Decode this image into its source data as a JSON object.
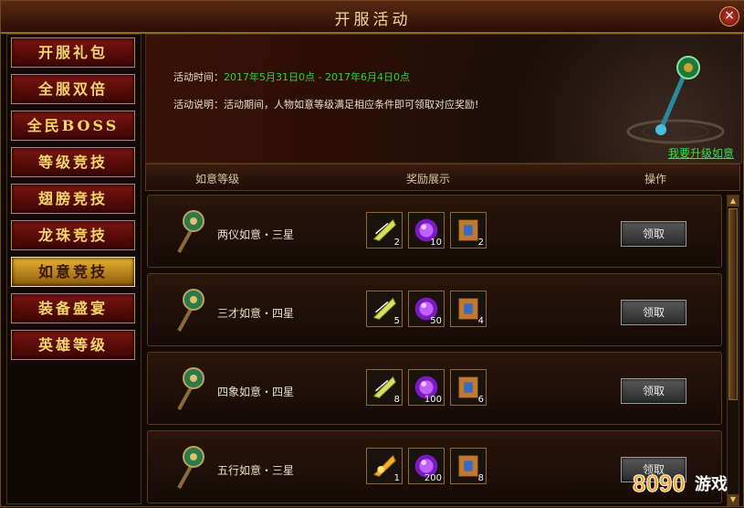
{
  "window": {
    "title": "开服活动",
    "close_label": "×"
  },
  "sidebar": {
    "items": [
      {
        "label": "开服礼包",
        "active": false
      },
      {
        "label": "全服双倍",
        "active": false
      },
      {
        "label": "全民BOSS",
        "active": false
      },
      {
        "label": "等级竞技",
        "active": false
      },
      {
        "label": "翅膀竞技",
        "active": false
      },
      {
        "label": "龙珠竞技",
        "active": false
      },
      {
        "label": "如意竞技",
        "active": true
      },
      {
        "label": "装备盛宴",
        "active": false
      },
      {
        "label": "英雄等级",
        "active": false
      }
    ]
  },
  "banner": {
    "time_label": "活动时间：",
    "time_value": "2017年5月31日0点 - 2017年6月4日0点",
    "desc_label": "活动说明：",
    "desc_value": "活动期间，人物如意等级满足相应条件即可领取对应奖励!",
    "upgrade_link": "我要升级如意"
  },
  "columns": {
    "level": "如意等级",
    "rewards": "奖励展示",
    "action": "操作"
  },
  "rows": [
    {
      "name": "两仪如意・三星",
      "icon": "ruyi-scepter-icon",
      "rewards": [
        {
          "icon": "wing-feather-icon",
          "count": "2"
        },
        {
          "icon": "purple-orb-icon",
          "count": "10"
        },
        {
          "icon": "scroll-icon",
          "count": "2"
        }
      ],
      "button": "领取"
    },
    {
      "name": "三才如意・四星",
      "icon": "ruyi-scepter-icon",
      "rewards": [
        {
          "icon": "wing-feather-icon",
          "count": "5"
        },
        {
          "icon": "purple-orb-icon",
          "count": "50"
        },
        {
          "icon": "scroll-icon",
          "count": "4"
        }
      ],
      "button": "领取"
    },
    {
      "name": "四象如意・四星",
      "icon": "ruyi-scepter-icon",
      "rewards": [
        {
          "icon": "wing-feather-icon",
          "count": "8"
        },
        {
          "icon": "purple-orb-icon",
          "count": "100"
        },
        {
          "icon": "scroll-icon",
          "count": "6"
        }
      ],
      "button": "领取"
    },
    {
      "name": "五行如意・三星",
      "icon": "ruyi-scepter-icon",
      "rewards": [
        {
          "icon": "golden-wing-icon",
          "count": "1"
        },
        {
          "icon": "purple-orb-icon",
          "count": "200"
        },
        {
          "icon": "scroll-icon",
          "count": "8"
        }
      ],
      "button": "领取"
    }
  ],
  "watermark": {
    "text": "8090游戏"
  },
  "colors": {
    "accent_gold": "#f5d66a",
    "link_green": "#3ae04a",
    "time_green": "#2fd23a"
  }
}
